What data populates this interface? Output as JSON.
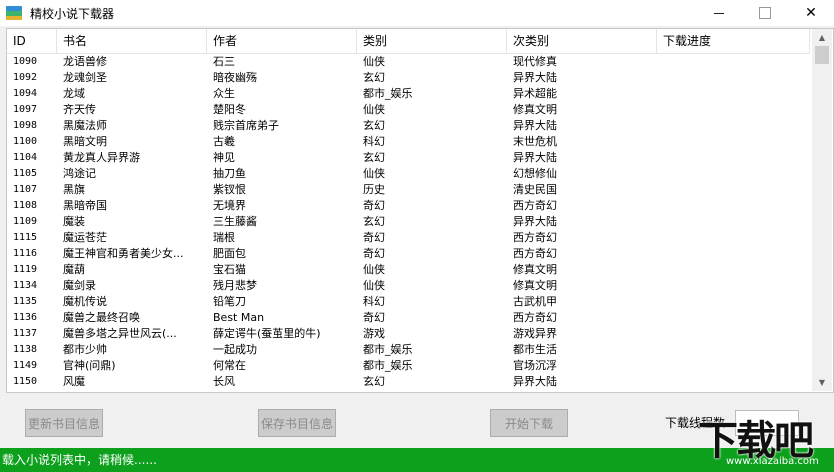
{
  "window": {
    "title": "精校小说下载器",
    "minimize": "—",
    "close": "✕"
  },
  "table": {
    "columns": [
      "ID",
      "书名",
      "作者",
      "类别",
      "次类别",
      "下载进度"
    ],
    "rows": [
      [
        "1090",
        "龙语兽修",
        "石三",
        "仙侠",
        "现代修真",
        ""
      ],
      [
        "1092",
        "龙魂剑圣",
        "暗夜幽殇",
        "玄幻",
        "异界大陆",
        ""
      ],
      [
        "1094",
        "龙域",
        "众生",
        "都市_娱乐",
        "异术超能",
        ""
      ],
      [
        "1097",
        "齐天传",
        "楚阳冬",
        "仙侠",
        "修真文明",
        ""
      ],
      [
        "1098",
        "黑魔法师",
        "贱宗首席弟子",
        "玄幻",
        "异界大陆",
        ""
      ],
      [
        "1100",
        "黑暗文明",
        "古羲",
        "科幻",
        "末世危机",
        ""
      ],
      [
        "1104",
        "黄龙真人异界游",
        "神见",
        "玄幻",
        "异界大陆",
        ""
      ],
      [
        "1105",
        "鸿途记",
        "抽刀鱼",
        "仙侠",
        "幻想修仙",
        ""
      ],
      [
        "1107",
        "黑旗",
        "紫钗恨",
        "历史",
        "清史民国",
        ""
      ],
      [
        "1108",
        "黑暗帝国",
        "无境界",
        "奇幻",
        "西方奇幻",
        ""
      ],
      [
        "1109",
        "魔装",
        "三生藤酱",
        "玄幻",
        "异界大陆",
        ""
      ],
      [
        "1115",
        "魔运苍茫",
        "瑞根",
        "奇幻",
        "西方奇幻",
        ""
      ],
      [
        "1116",
        "魔王神官和勇者美少女...",
        "肥面包",
        "奇幻",
        "西方奇幻",
        ""
      ],
      [
        "1119",
        "魔葫",
        "宝石猫",
        "仙侠",
        "修真文明",
        ""
      ],
      [
        "1134",
        "魔剑录",
        "残月悲梦",
        "仙侠",
        "修真文明",
        ""
      ],
      [
        "1135",
        "魔机传说",
        "铅笔刀",
        "科幻",
        "古武机甲",
        ""
      ],
      [
        "1136",
        "魔兽之最终召唤",
        "Best Man",
        "奇幻",
        "西方奇幻",
        ""
      ],
      [
        "1137",
        "魔兽多塔之异世风云(...",
        "薛定谔牛(蚕茧里的牛)",
        "游戏",
        "游戏异界",
        ""
      ],
      [
        "1138",
        "都市少帅",
        "一起成功",
        "都市_娱乐",
        "都市生活",
        ""
      ],
      [
        "1149",
        "官神(问鼎)",
        "何常在",
        "都市_娱乐",
        "官场沉浮",
        ""
      ],
      [
        "1150",
        "风魔",
        "长风",
        "玄幻",
        "异界大陆",
        ""
      ],
      [
        "",
        "",
        "",
        "",
        "",
        ""
      ]
    ]
  },
  "buttons": {
    "update_info": "更新书目信息",
    "save_info": "保存书目信息",
    "start_download": "开始下载"
  },
  "progress": {
    "label": "下载线程数"
  },
  "status": {
    "text": "载入小说列表中，请稍候......"
  },
  "watermark": {
    "main": "下载吧",
    "sub": "www.xiazaiba.com"
  },
  "colors": {
    "status_bar": "#0ca01c",
    "button_bg": "#cccccc",
    "button_text": "#8a8a8a"
  }
}
